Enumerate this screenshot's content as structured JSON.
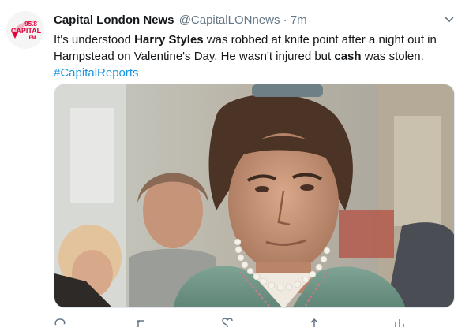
{
  "tweet": {
    "author": {
      "name": "Capital London News",
      "handle": "@CapitalLONnews",
      "avatar": {
        "frequency": "95.8",
        "brand": "CAPITAL",
        "band": "FM",
        "brand_color": "#e2003a"
      }
    },
    "separator": "·",
    "timestamp": "7m",
    "text": {
      "part1": "It's understood ",
      "bold1": "Harry Styles",
      "part2": " was robbed at knife point after a night out in Hampstead on Valentine's Day. He wasn't injured but ",
      "bold2": "cash",
      "part3": " was stolen. ",
      "hashtag": "#CapitalReports"
    },
    "link_color": "#1b95e0",
    "media": {
      "alt_subject": "photo-of-man-in-street"
    },
    "actions": [
      "reply-icon",
      "retweet-icon",
      "like-icon",
      "share-icon",
      "analytics-icon"
    ]
  }
}
